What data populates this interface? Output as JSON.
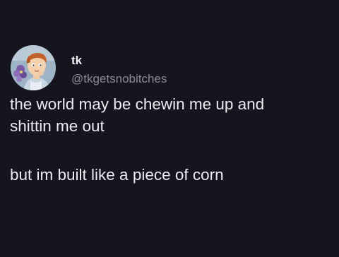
{
  "tweet": {
    "display_name": "tk",
    "handle": "@tkgetsnobitches",
    "avatar_icon": "cartoon-avatar-icon",
    "text_line_1": "the world may be chewin me up and",
    "text_line_2": "shittin me out",
    "text_paragraph_2": "but im built like a piece of corn"
  },
  "colors": {
    "background": "#15141f",
    "text": "#ebebf0",
    "handle": "#8b8a97"
  }
}
